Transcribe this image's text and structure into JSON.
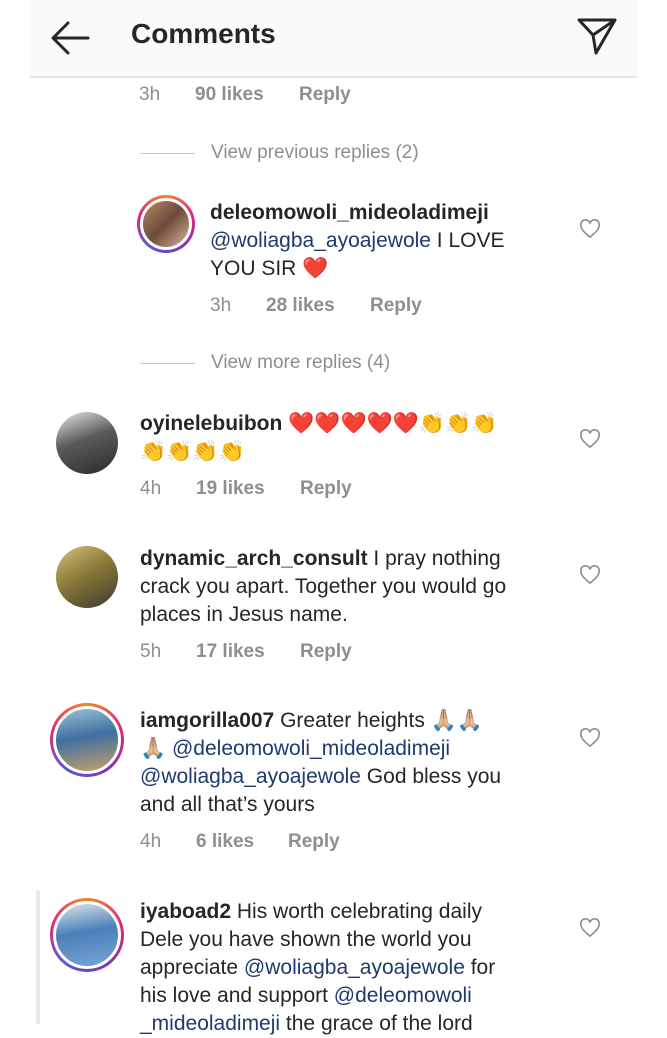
{
  "header": {
    "title": "Comments"
  },
  "top_meta": {
    "time": "3h",
    "likes": "90 likes",
    "reply": "Reply"
  },
  "view_previous": "View previous replies (2)",
  "view_more": "View more replies (4)",
  "reply1": {
    "username": "deleomowoli_mideoladimeji",
    "mention": "@woliagba_ayoajewole",
    "text": " I LOVE",
    "text2": "YOU SIR ❤️",
    "time": "3h",
    "likes": "28 likes",
    "reply": "Reply"
  },
  "c1": {
    "username": "oyinelebuibon",
    "text": " ❤️❤️❤️❤️❤️👏👏👏",
    "text2": "👏👏👏👏",
    "time": "4h",
    "likes": "19 likes",
    "reply": "Reply"
  },
  "c2": {
    "username": "dynamic_arch_consult",
    "text": " I pray nothing",
    "line2": "crack you apart. Together you would go",
    "line3": "places in Jesus name.",
    "time": "5h",
    "likes": "17 likes",
    "reply": "Reply"
  },
  "c3": {
    "username": "iamgorilla007",
    "text": " Greater heights 🙏🏼🙏🏼",
    "pray": "🙏🏼 ",
    "mention1": "@deleomowoli_mideoladimeji",
    "mention2": "@woliagba_ayoajewole",
    "text2": " God bless you",
    "line4": "and all that’s yours",
    "time": "4h",
    "likes": "6 likes",
    "reply": "Reply"
  },
  "c4": {
    "username": "iyaboad2",
    "text": " His worth celebrating daily",
    "line2": "Dele you have shown the world you",
    "line3a": "appreciate ",
    "mention1": "@woliagba_ayoajewole",
    "line3b": " for",
    "line4a": "his love and support ",
    "mention2": "@deleomowoli",
    "line5a": "_mideoladimeji",
    "line5b": " the grace of the lord"
  },
  "colors": {
    "mention": "#1e3a6e",
    "meta": "#8e8e8e",
    "heart_red": "#e0102a"
  }
}
